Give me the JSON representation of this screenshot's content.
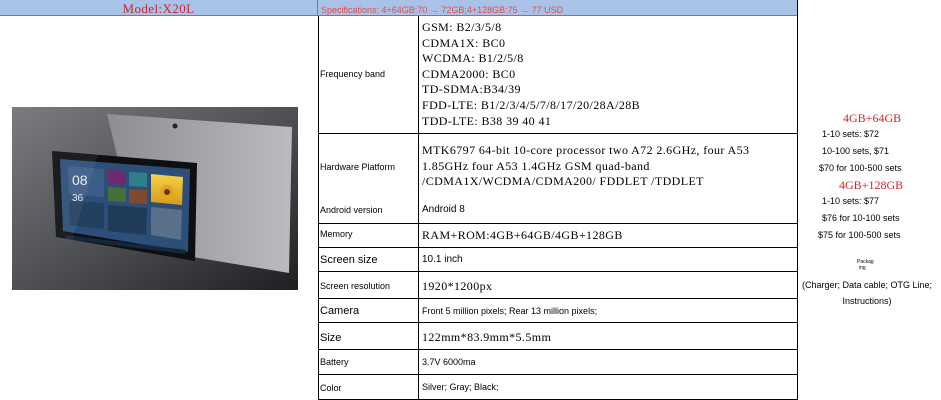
{
  "header": {
    "model": "Model:X20L",
    "specifications": "Specifications: 4+64GB:70 → 72GB;4+128GB:75 → 77 USD"
  },
  "specs": [
    {
      "label": "Frequency band",
      "values": [
        "GSM: B2/3/5/8",
        "CDMA1X: BC0",
        "WCDMA: B1/2/5/8",
        "CDMA2000: BC0",
        "TD-SDMA:B34/39",
        "FDD-LTE: B1/2/3/4/5/7/8/17/20/28A/28B",
        "TDD-LTE: B38 39 40 41"
      ]
    },
    {
      "label": "Hardware Platform",
      "value": "MTK6797 64-bit 10-core processor two A72 2.6GHz, four A53 1.85GHz four A53 1.4GHz GSM quad-band /CDMA1X/WCDMA/CDMA200/ FDDLET /TDDLET"
    },
    {
      "label": "Android version",
      "value": "Android 8"
    },
    {
      "label": "Memory",
      "value": "RAM+ROM:4GB+64GB/4GB+128GB"
    },
    {
      "label": "Screen size",
      "value": "10.1 inch"
    },
    {
      "label": "Screen resolution",
      "value": "1920*1200px"
    },
    {
      "label": "Camera",
      "value": "Front 5 million pixels; Rear 13 million pixels;"
    },
    {
      "label": "Size",
      "value": "122mm*83.9mm*5.5mm"
    },
    {
      "label": "Battery",
      "value": "3.7V 6000ma"
    },
    {
      "label": "Color",
      "value": "Silver; Gray; Black;"
    }
  ],
  "pricing": {
    "group1_title": "4GB+64GB",
    "group1": [
      "1-10 sets: $72",
      "10-100 sets, $71",
      "$70 for 100-500 sets"
    ],
    "group2_title": "4GB+128GB",
    "group2": [
      "1-10 sets: $77",
      "$76 for 10-100 sets",
      "$75 for 100-500 sets"
    ],
    "packaging_line1": "Packag",
    "packaging_line2": "ing",
    "packaging_text": "(Charger; Data cable; OTG Line; Instructions)"
  },
  "tablet_screen": {
    "clock": "08",
    "clock_sub": "36"
  }
}
